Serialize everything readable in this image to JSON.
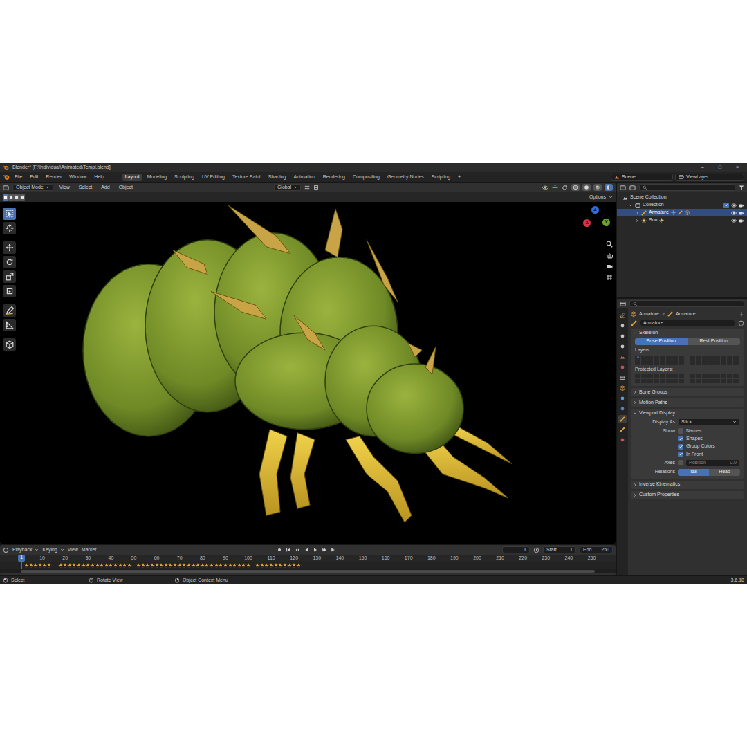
{
  "window": {
    "title": "Blender* [F:\\Individual\\Animated\\Templ.blend]",
    "controls": [
      "–",
      "□",
      "×"
    ]
  },
  "menu": [
    "File",
    "Edit",
    "Render",
    "Window",
    "Help"
  ],
  "workspaces": [
    {
      "label": "Layout",
      "selected": true
    },
    {
      "label": "Modeling",
      "selected": false
    },
    {
      "label": "Sculpting",
      "selected": false
    },
    {
      "label": "UV Editing",
      "selected": false
    },
    {
      "label": "Texture Paint",
      "selected": false
    },
    {
      "label": "Shading",
      "selected": false
    },
    {
      "label": "Animation",
      "selected": false
    },
    {
      "label": "Rendering",
      "selected": false
    },
    {
      "label": "Compositing",
      "selected": false
    },
    {
      "label": "Geometry Nodes",
      "selected": false
    },
    {
      "label": "Scripting",
      "selected": false
    }
  ],
  "add_workspace": "+",
  "scene": "Scene",
  "view_layer": "ViewLayer",
  "viewport": {
    "mode": "Object Mode",
    "menus": [
      "View",
      "Select",
      "Add",
      "Object"
    ],
    "orientation": "Global",
    "options": "Options",
    "select_modes": [
      {
        "selected": true
      },
      {
        "selected": false
      },
      {
        "selected": false
      },
      {
        "selected": false
      }
    ],
    "shading": [
      {
        "kind": "wire",
        "selected": false
      },
      {
        "kind": "solid",
        "selected": false
      },
      {
        "kind": "material",
        "selected": false
      },
      {
        "kind": "rendered",
        "selected": true
      }
    ],
    "toolbar": [
      {
        "kind": "select",
        "selected": true
      },
      {
        "kind": "cursor",
        "selected": false
      },
      {
        "kind": "move",
        "selected": false
      },
      {
        "kind": "rotate",
        "selected": false
      },
      {
        "kind": "scale",
        "selected": false
      },
      {
        "kind": "transform",
        "selected": false
      },
      {
        "kind": "annotate",
        "selected": false
      },
      {
        "kind": "measure",
        "selected": false
      },
      {
        "kind": "cube",
        "selected": false
      }
    ],
    "gizmo": [
      {
        "label": "Z",
        "color": "#2f6ee0"
      },
      {
        "label": "Y",
        "color": "#6aa629"
      },
      {
        "label": "X",
        "color": "#d7374b"
      }
    ],
    "nav": [
      {
        "kind": "zoom"
      },
      {
        "kind": "hand"
      },
      {
        "kind": "camera"
      },
      {
        "kind": "grid"
      }
    ]
  },
  "outliner": {
    "items": [
      {
        "label": "Scene Collection",
        "kind": "scene",
        "depth": 0,
        "selected": false
      },
      {
        "label": "Collection",
        "kind": "collection",
        "depth": 1,
        "selected": false,
        "expanded": true,
        "enabled": true,
        "visible": true,
        "renderable": true
      },
      {
        "label": "Armature",
        "kind": "armature",
        "depth": 2,
        "selected": true,
        "expanded": false,
        "visible": true,
        "renderable": true
      },
      {
        "label": "Sun",
        "kind": "sun",
        "depth": 2,
        "selected": false,
        "expanded": false,
        "visible": true,
        "renderable": true
      }
    ]
  },
  "properties": {
    "tabs": [
      {
        "kind": "tool",
        "selected": false
      },
      {
        "kind": "render",
        "selected": false
      },
      {
        "kind": "output",
        "selected": false
      },
      {
        "kind": "view_layer",
        "selected": false
      },
      {
        "kind": "scene",
        "selected": false
      },
      {
        "kind": "world",
        "selected": false
      },
      {
        "kind": "collection",
        "selected": false
      },
      {
        "kind": "object",
        "selected": false
      },
      {
        "kind": "physics",
        "selected": false
      },
      {
        "kind": "constraints",
        "selected": false
      },
      {
        "kind": "data",
        "selected": true
      },
      {
        "kind": "bone",
        "selected": false
      },
      {
        "kind": "texture",
        "selected": false
      }
    ],
    "breadcrumb": [
      "Armature",
      "Armature"
    ],
    "breadcrumb_separator": ">",
    "datablock": "Armature",
    "panels": [
      {
        "kind": "skeleton",
        "title": "Skeleton",
        "expanded": true,
        "position": [
          {
            "label": "Pose Position",
            "selected": true
          },
          {
            "label": "Rest Position",
            "selected": false
          }
        ],
        "layers_label": "Layers:",
        "active_layers": [
          0
        ],
        "protected_label": "Protected Layers:",
        "protected_layers": []
      },
      {
        "kind": "collapsed",
        "title": "Bone Groups",
        "expanded": false
      },
      {
        "kind": "collapsed",
        "title": "Motion Paths",
        "expanded": false
      },
      {
        "kind": "display",
        "title": "Viewport Display",
        "expanded": true,
        "rows": [
          {
            "kind": "select",
            "label": "Display As",
            "value": "Stick"
          },
          {
            "kind": "checks",
            "label": "Show",
            "checks": [
              {
                "label": "Names",
                "checked": false
              },
              {
                "label": "Shapes",
                "checked": true
              },
              {
                "label": "Group Colors",
                "checked": true
              },
              {
                "label": "In Front",
                "checked": true
              }
            ]
          },
          {
            "kind": "axes",
            "label": "Axes",
            "checked": false,
            "field_label": "Position",
            "field_value": "0.0"
          },
          {
            "kind": "toggle",
            "label": "Relations",
            "options": [
              {
                "label": "Tail",
                "selected": true
              },
              {
                "label": "Head",
                "selected": false
              }
            ]
          }
        ]
      },
      {
        "kind": "collapsed",
        "title": "Inverse Kinematics",
        "expanded": false
      },
      {
        "kind": "collapsed",
        "title": "Custom Properties",
        "expanded": false
      }
    ]
  },
  "timeline": {
    "menus": [
      "Playback",
      "Keying",
      "View",
      "Marker"
    ],
    "playhead": "1",
    "frame": "1",
    "start_label": "Start",
    "start": "1",
    "end_label": "End",
    "end": "250",
    "ticks": [
      "10",
      "20",
      "30",
      "40",
      "50",
      "60",
      "70",
      "80",
      "90",
      "100",
      "110",
      "120",
      "130",
      "140",
      "150",
      "160",
      "170",
      "180",
      "190",
      "200",
      "210",
      "220",
      "230",
      "240",
      "250"
    ],
    "keyframes": [
      3,
      5,
      7,
      9,
      11,
      13,
      18,
      20,
      22,
      24,
      26,
      28,
      30,
      32,
      34,
      36,
      38,
      40,
      42,
      44,
      46,
      48,
      52,
      54,
      56,
      58,
      60,
      62,
      64,
      66,
      68,
      70,
      72,
      74,
      76,
      78,
      80,
      82,
      84,
      86,
      88,
      90,
      92,
      94,
      96,
      98,
      100,
      104,
      106,
      108,
      110,
      112,
      114,
      116,
      118,
      120,
      122
    ]
  },
  "status_bar": {
    "items": [
      {
        "label": "Select",
        "kind": "lmb"
      },
      {
        "label": "Rotate View",
        "kind": "mmb"
      },
      {
        "label": "Object Context Menu",
        "kind": "rmb"
      }
    ],
    "version": "3.6.18"
  }
}
